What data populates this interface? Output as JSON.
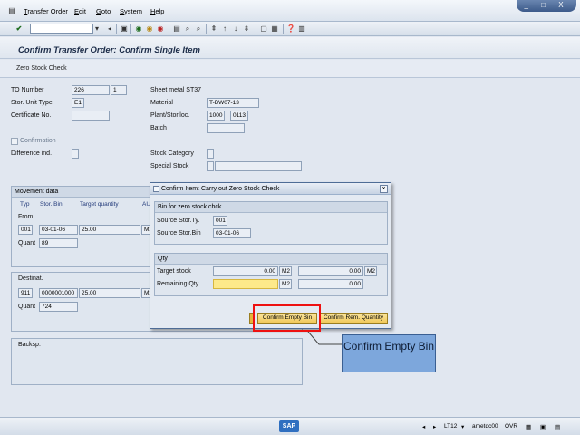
{
  "menu": [
    "Transfer Order",
    "Edit",
    "Goto",
    "System",
    "Help"
  ],
  "window_controls": "_ □ X",
  "title": "Confirm Transfer Order: Confirm Single Item",
  "app_toolbar": {
    "zero_stock_check": "Zero Stock Check"
  },
  "header": {
    "to_number_label": "TO Number",
    "to_number": "226",
    "to_item": "1",
    "stor_unit_type_label": "Stor. Unit Type",
    "stor_unit_type": "E1",
    "certificate_label": "Certificate No.",
    "material_desc": "Sheet metal ST37",
    "material_label": "Material",
    "material": "T-BW07-13",
    "plant_label": "Plant/Stor.loc.",
    "plant": "1000",
    "stor_loc": "0113",
    "batch_label": "Batch",
    "confirmation_label": "Confirmation",
    "difference_label": "Difference ind.",
    "stock_category_label": "Stock Category",
    "special_stock_label": "Special Stock"
  },
  "movement": {
    "title": "Movement data",
    "columns": [
      "Typ",
      "Stor. Bin",
      "Target quantity",
      "AU"
    ],
    "from_label": "From",
    "from_typ": "001",
    "from_bin": "03-01-06",
    "from_qty": "25.00",
    "from_unit": "M2",
    "from_quant_label": "Quant",
    "from_quant": "89",
    "dest_label": "Destinat.",
    "dest_typ": "911",
    "dest_bin": "0000001000",
    "dest_qty": "25.00",
    "dest_unit": "M2",
    "dest_quant_label": "Quant",
    "dest_quant": "724",
    "backsp_label": "Backsp."
  },
  "dialog": {
    "title": "Confirm Item: Carry out Zero Stock Check",
    "bin_group": "Bin for zero stock chck",
    "source_type_label": "Source Stor.Ty.",
    "source_type": "001",
    "source_bin_label": "Source Stor.Bin",
    "source_bin": "03-01-06",
    "qty_group": "Qty",
    "target_stock_label": "Target stock",
    "target_stock": "0.00",
    "target_unit": "M2",
    "target_stock2": "0.00",
    "target_unit2": "M2",
    "remaining_label": "Remaining Qty.",
    "remaining_unit": "M2",
    "remaining2": "0.00",
    "btn_confirm_empty": "Confirm Empty Bin",
    "btn_confirm_rem": "Confirm Rem. Quantity"
  },
  "callout": "Confirm Empty Bin",
  "status": {
    "tcode": "LT12",
    "user": "ametdc00",
    "mode": "OVR",
    "sap": "SAP"
  }
}
